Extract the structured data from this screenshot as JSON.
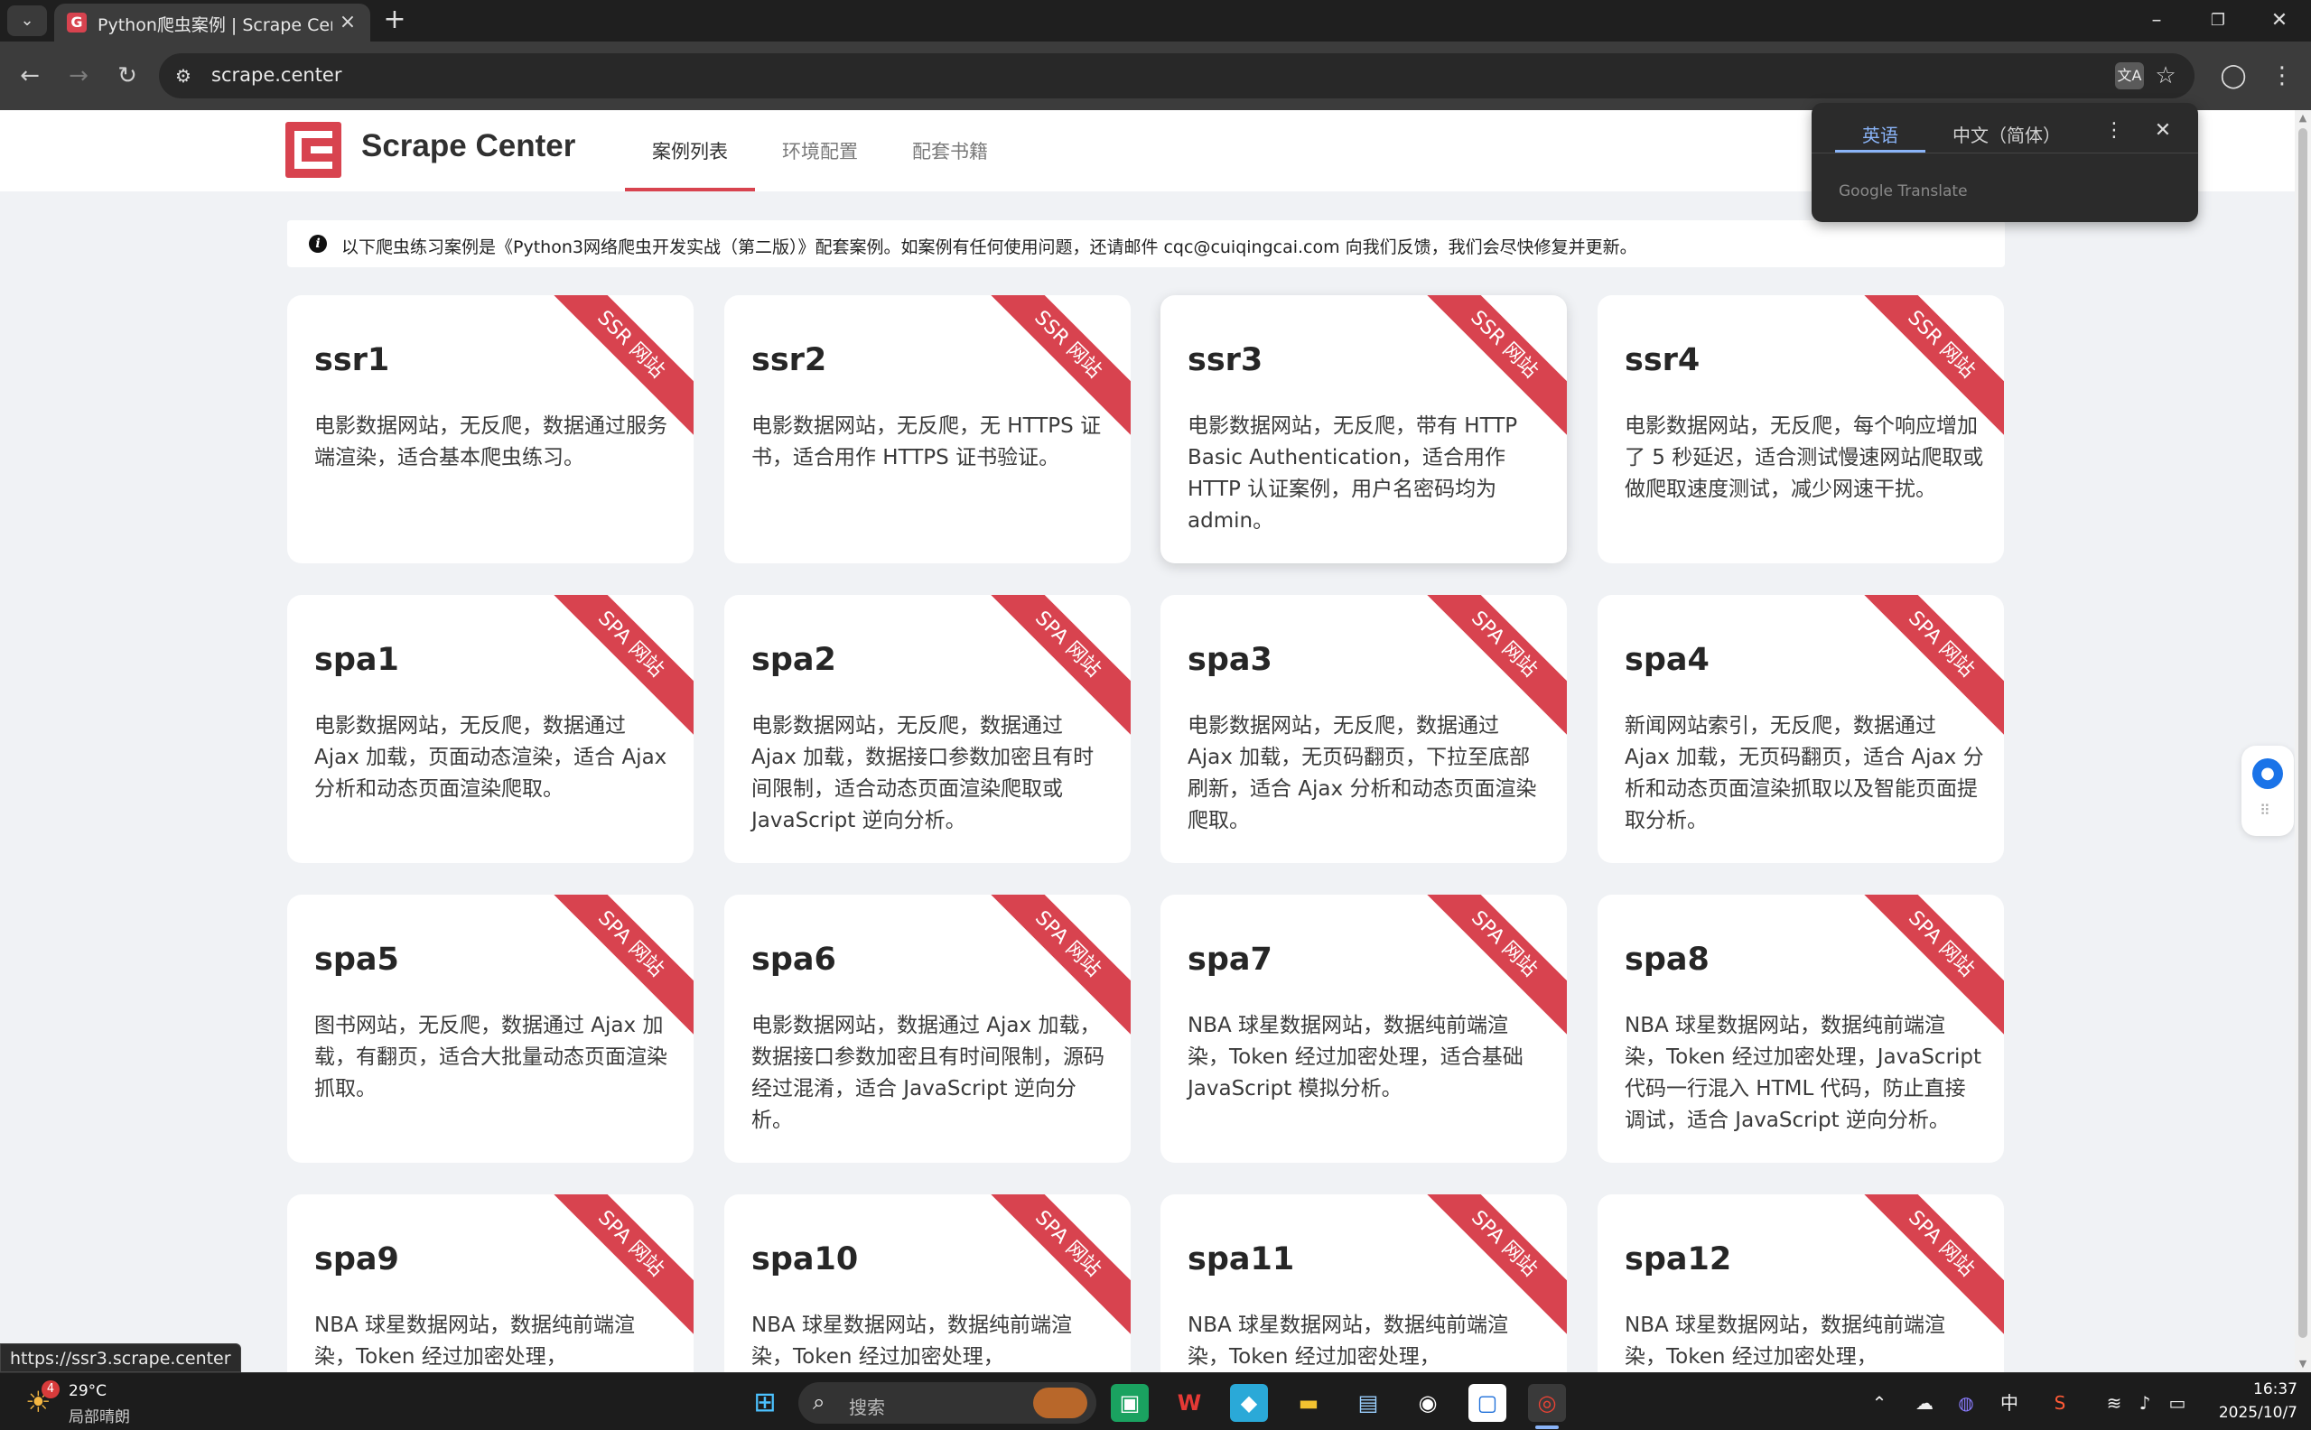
{
  "browser": {
    "tab_title": "Python爬虫案例 | Scrape Center",
    "url": "scrape.center",
    "status_url": "https://ssr3.scrape.center"
  },
  "translate_popup": {
    "tab_source": "英语",
    "tab_target": "中文（简体）",
    "brand": "Google Translate"
  },
  "site": {
    "brand": "Scrape Center",
    "nav": [
      "案例列表",
      "环境配置",
      "配套书籍"
    ],
    "notice": "以下爬虫练习案例是《Python3网络爬虫开发实战（第二版）》配套案例。如案例有任何使用问题，还请邮件 cqc@cuiqingcai.com 向我们反馈，我们会尽快修复并更新。"
  },
  "cards": [
    {
      "title": "ssr1",
      "ribbon": "SSR 网站",
      "desc": "电影数据网站，无反爬，数据通过服务端渲染，适合基本爬虫练习。"
    },
    {
      "title": "ssr2",
      "ribbon": "SSR 网站",
      "desc": "电影数据网站，无反爬，无 HTTPS 证书，适合用作 HTTPS 证书验证。"
    },
    {
      "title": "ssr3",
      "ribbon": "SSR 网站",
      "desc": "电影数据网站，无反爬，带有 HTTP Basic Authentication，适合用作 HTTP 认证案例，用户名密码均为 admin。"
    },
    {
      "title": "ssr4",
      "ribbon": "SSR 网站",
      "desc": "电影数据网站，无反爬，每个响应增加了 5 秒延迟，适合测试慢速网站爬取或做爬取速度测试，减少网速干扰。"
    },
    {
      "title": "spa1",
      "ribbon": "SPA 网站",
      "desc": "电影数据网站，无反爬，数据通过 Ajax 加载，页面动态渲染，适合 Ajax 分析和动态页面渲染爬取。"
    },
    {
      "title": "spa2",
      "ribbon": "SPA 网站",
      "desc": "电影数据网站，无反爬，数据通过 Ajax 加载，数据接口参数加密且有时间限制，适合动态页面渲染爬取或 JavaScript 逆向分析。"
    },
    {
      "title": "spa3",
      "ribbon": "SPA 网站",
      "desc": "电影数据网站，无反爬，数据通过 Ajax 加载，无页码翻页，下拉至底部刷新，适合 Ajax 分析和动态页面渲染爬取。"
    },
    {
      "title": "spa4",
      "ribbon": "SPA 网站",
      "desc": "新闻网站索引，无反爬，数据通过 Ajax 加载，无页码翻页，适合 Ajax 分析和动态页面渲染抓取以及智能页面提取分析。"
    },
    {
      "title": "spa5",
      "ribbon": "SPA 网站",
      "desc": "图书网站，无反爬，数据通过 Ajax 加载，有翻页，适合大批量动态页面渲染抓取。"
    },
    {
      "title": "spa6",
      "ribbon": "SPA 网站",
      "desc": "电影数据网站，数据通过 Ajax 加载，数据接口参数加密且有时间限制，源码经过混淆，适合 JavaScript 逆向分析。"
    },
    {
      "title": "spa7",
      "ribbon": "SPA 网站",
      "desc": "NBA 球星数据网站，数据纯前端渲染，Token 经过加密处理，适合基础 JavaScript 模拟分析。"
    },
    {
      "title": "spa8",
      "ribbon": "SPA 网站",
      "desc": "NBA 球星数据网站，数据纯前端渲染，Token 经过加密处理，JavaScript 代码一行混入 HTML 代码，防止直接调试，适合 JavaScript 逆向分析。"
    },
    {
      "title": "spa9",
      "ribbon": "SPA 网站",
      "desc": "NBA 球星数据网站，数据纯前端渲染，Token 经过加密处理，"
    },
    {
      "title": "spa10",
      "ribbon": "SPA 网站",
      "desc": "NBA 球星数据网站，数据纯前端渲染，Token 经过加密处理，"
    },
    {
      "title": "spa11",
      "ribbon": "SPA 网站",
      "desc": "NBA 球星数据网站，数据纯前端渲染，Token 经过加密处理，"
    },
    {
      "title": "spa12",
      "ribbon": "SPA 网站",
      "desc": "NBA 球星数据网站，数据纯前端渲染，Token 经过加密处理，"
    }
  ],
  "taskbar": {
    "weather_temp": "29°C",
    "weather_desc": "局部晴朗",
    "weather_badge": "4",
    "search_placeholder": "搜索",
    "ime": "中",
    "time": "16:37",
    "date": "2025/10/7"
  },
  "colors": {
    "brand_red": "#d8434f",
    "browser_dark": "#3c3c3c",
    "page_bg": "#f0f2f5"
  }
}
